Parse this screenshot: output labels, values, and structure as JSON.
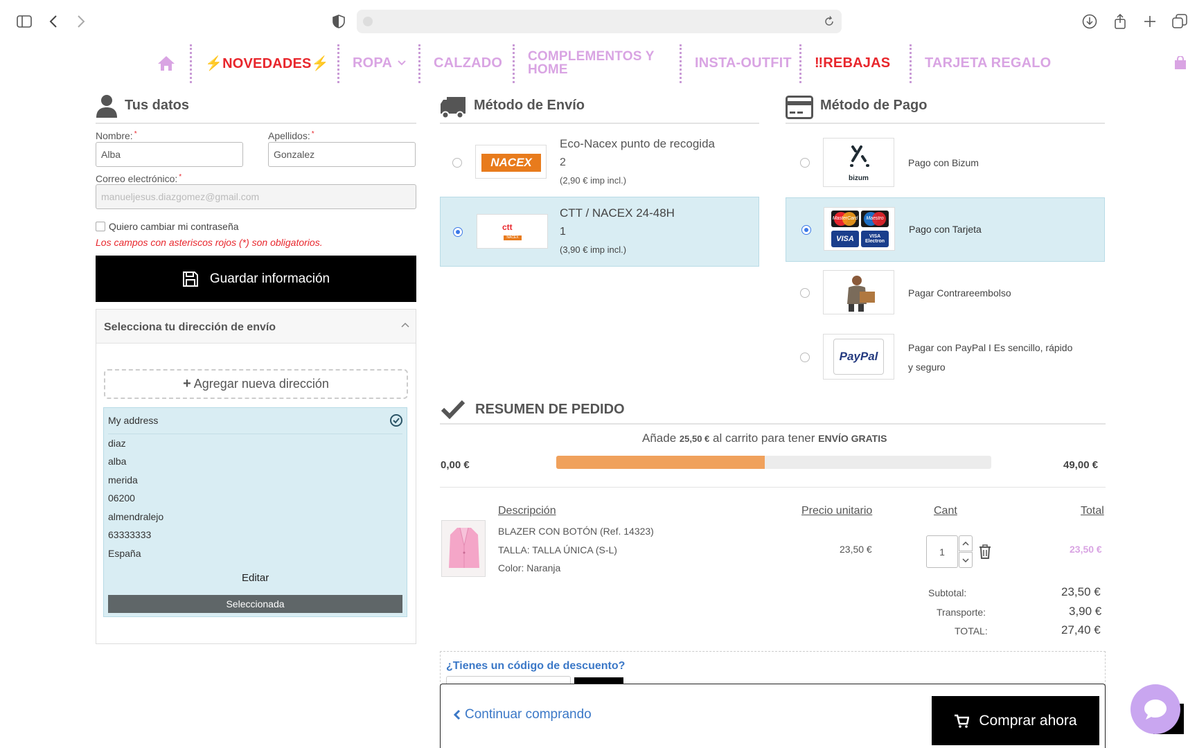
{
  "nav": {
    "novedades": "⚡NOVEDADES⚡",
    "ropa": "ROPA",
    "calzado": "CALZADO",
    "complementos_1": "COMPLEMENTOS Y",
    "complementos_2": "HOME",
    "insta": "INSTA-OUTFIT",
    "rebajas": "‼REBAJAS",
    "tarjeta": "TARJETA REGALO"
  },
  "tus_datos": {
    "title": "Tus datos",
    "nombre_label": "Nombre:",
    "nombre_value": "Alba",
    "apellidos_label": "Apellidos:",
    "apellidos_value": "Gonzalez",
    "correo_label": "Correo electrónico:",
    "correo_value": "manueljesus.diazgomez@gmail.com",
    "asterisk": "*",
    "cambiar_password": "Quiero cambiar mi contraseña",
    "obligatorios_note": "Los campos con asteriscos rojos (*) son obligatorios.",
    "guardar_label": "Guardar información"
  },
  "direccion": {
    "header": "Selecciona tu dirección de envío",
    "agregar_label": "Agregar nueva dirección",
    "card_title": "My address",
    "lines": [
      "diaz",
      "alba",
      "merida",
      "06200",
      "almendralejo",
      "63333333",
      "España"
    ],
    "editar_label": "Editar",
    "seleccionada_label": "Seleccionada"
  },
  "envio": {
    "title": "Método de Envío",
    "options": [
      {
        "name": "Eco-Nacex punto de recogida",
        "days": "2",
        "price": "(2,90 € imp incl.)",
        "logo": "NACEX",
        "selected": false
      },
      {
        "name": "CTT / NACEX 24-48H",
        "days": "1",
        "price": "(3,90 € imp incl.)",
        "logo": "ctt",
        "logo_sub": "NACEX",
        "selected": true
      }
    ]
  },
  "pago": {
    "title": "Método de Pago",
    "options": [
      {
        "label": "Pago con Bizum",
        "logo_text": "bizum",
        "selected": false
      },
      {
        "label": "Pago con Tarjeta",
        "logo_texts": [
          "MasterCard",
          "Maestro",
          "VISA",
          "VISA Electron"
        ],
        "selected": true
      },
      {
        "label": "Pagar Contrareembolso",
        "selected": false
      },
      {
        "label_1": "Pagar con PayPal I Es sencillo, rápido",
        "label_2": "y seguro",
        "logo_text": "PayPal",
        "selected": false
      }
    ]
  },
  "resumen": {
    "title": "RESUMEN DE PEDIDO",
    "envio_pre": "Añade",
    "envio_amount": "25,50 €",
    "envio_mid": "al carrito para tener",
    "envio_post": "ENVÍO GRATIS",
    "progress_min": "0,00 €",
    "progress_max": "49,00 €",
    "progress_fraction": 0.48,
    "headers": {
      "descripcion": "Descripción",
      "precio": "Precio unitario",
      "cant": "Cant",
      "total": "Total"
    },
    "item": {
      "name": "BLAZER CON BOTÓN (Ref. 14323)",
      "talla": "TALLA: TALLA ÚNICA (S-L)",
      "color": "Color: Naranja",
      "precio": "23,50 €",
      "cant": "1",
      "total": "23,50 €"
    },
    "subtotal_label": "Subtotal:",
    "subtotal": "23,50 €",
    "transporte_label": "Transporte:",
    "transporte": "3,90 €",
    "total_label": "TOTAL:",
    "total": "27,40 €",
    "descuento_label": "¿Tienes un código de descuento?"
  },
  "footer": {
    "continuar": "Continuar comprando",
    "comprar": "Comprar ahora"
  },
  "colors": {
    "accent": "#d9a4e3",
    "red": "#e8262c",
    "progress": "#f0a15c",
    "selected": "#d9edf3",
    "link": "#3b78c7"
  }
}
